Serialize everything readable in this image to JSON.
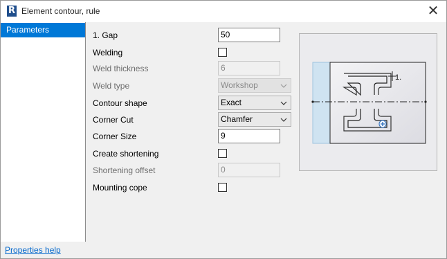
{
  "window": {
    "app_icon_letter": "R",
    "title": "Element contour, rule",
    "close_icon": "close-icon"
  },
  "sidebar": {
    "items": [
      {
        "label": "Parameters",
        "selected": true
      }
    ]
  },
  "fields": {
    "gap": {
      "label": "1. Gap",
      "value": "50"
    },
    "welding": {
      "label": "Welding",
      "checked": false
    },
    "weld_thickness": {
      "label": "Weld thickness",
      "value": "6",
      "disabled": true
    },
    "weld_type": {
      "label": "Weld type",
      "value": "Workshop",
      "disabled": true
    },
    "contour_shape": {
      "label": "Contour shape",
      "value": "Exact"
    },
    "corner_cut": {
      "label": "Corner Cut",
      "value": "Chamfer"
    },
    "corner_size": {
      "label": "Corner Size",
      "value": "9"
    },
    "create_shortening": {
      "label": "Create shortening",
      "checked": false
    },
    "shortening_offset": {
      "label": "Shortening offset",
      "value": "0",
      "disabled": true
    },
    "mounting_cope": {
      "label": "Mounting cope",
      "checked": false
    }
  },
  "preview": {
    "annotation": "1."
  },
  "footer": {
    "help_link": "Properties help"
  },
  "colors": {
    "selection": "#0078d7",
    "link": "#0066cc",
    "preview_highlight": "#cfe3f1"
  }
}
